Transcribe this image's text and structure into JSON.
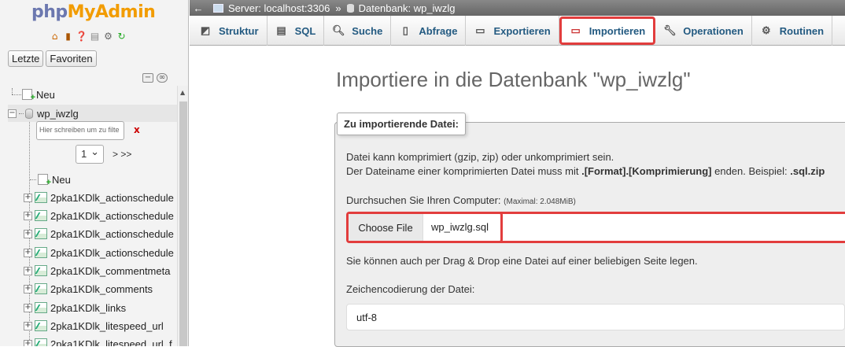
{
  "nav": {
    "logo_php": "php",
    "logo_my": "My",
    "logo_admin": "Admin",
    "icons": [
      "home-icon",
      "exit-icon",
      "help-icon",
      "docs-icon",
      "settings-icon",
      "reload-icon"
    ],
    "recent_label": "Letzte",
    "favorites_label": "Favoriten",
    "new_root_label": "Neu",
    "db_name": "wp_iwzlg",
    "filter_placeholder": "Hier schreiben um zu filte",
    "filter_clear": "x",
    "page_value": "1",
    "page_next": "> >>",
    "new_table_label": "Neu",
    "tables": [
      "2pka1KDlk_actionschedule",
      "2pka1KDlk_actionschedule",
      "2pka1KDlk_actionschedule",
      "2pka1KDlk_actionschedule",
      "2pka1KDlk_commentmeta",
      "2pka1KDlk_comments",
      "2pka1KDlk_links",
      "2pka1KDlk_litespeed_url",
      "2pka1KDlk_litespeed_url_f"
    ]
  },
  "breadcrumb": {
    "back": "←",
    "server": "Server: localhost:3306",
    "sep": "»",
    "database": "Datenbank: wp_iwzlg"
  },
  "tabs": [
    {
      "label": "Struktur",
      "icon": "structure-icon"
    },
    {
      "label": "SQL",
      "icon": "sql-icon"
    },
    {
      "label": "Suche",
      "icon": "search-icon"
    },
    {
      "label": "Abfrage",
      "icon": "query-icon"
    },
    {
      "label": "Exportieren",
      "icon": "export-icon"
    },
    {
      "label": "Importieren",
      "icon": "import-icon",
      "active": true
    },
    {
      "label": "Operationen",
      "icon": "wrench-icon"
    },
    {
      "label": "Routinen",
      "icon": "routines-icon"
    }
  ],
  "main": {
    "title": "Importiere in die Datenbank \"wp_iwzlg\"",
    "legend": "Zu importierende Datei:",
    "compress_line1": "Datei kann komprimiert (gzip, zip) oder unkomprimiert sein.",
    "compress_line2_prefix": "Der Dateiname einer komprimierten Datei muss mit ",
    "compress_line2_bold1": ".[Format].[Komprimierung]",
    "compress_line2_mid": " enden. Beispiel: ",
    "compress_line2_bold2": ".sql.zip",
    "browse_label": "Durchsuchen Sie Ihren Computer: ",
    "max_size": "(Maximal: 2.048MiB)",
    "choose_file_label": "Choose File",
    "file_name": "wp_iwzlg.sql",
    "drag_drop_hint": "Sie können auch per Drag & Drop eine Datei auf einer beliebigen Seite legen.",
    "charset_label": "Zeichencodierung der Datei:",
    "charset_value": "utf-8"
  },
  "colors": {
    "highlight": "#e23d3d",
    "tab_text": "#235a81",
    "logo_blue": "#6c78af",
    "logo_orange": "#f29c00"
  }
}
